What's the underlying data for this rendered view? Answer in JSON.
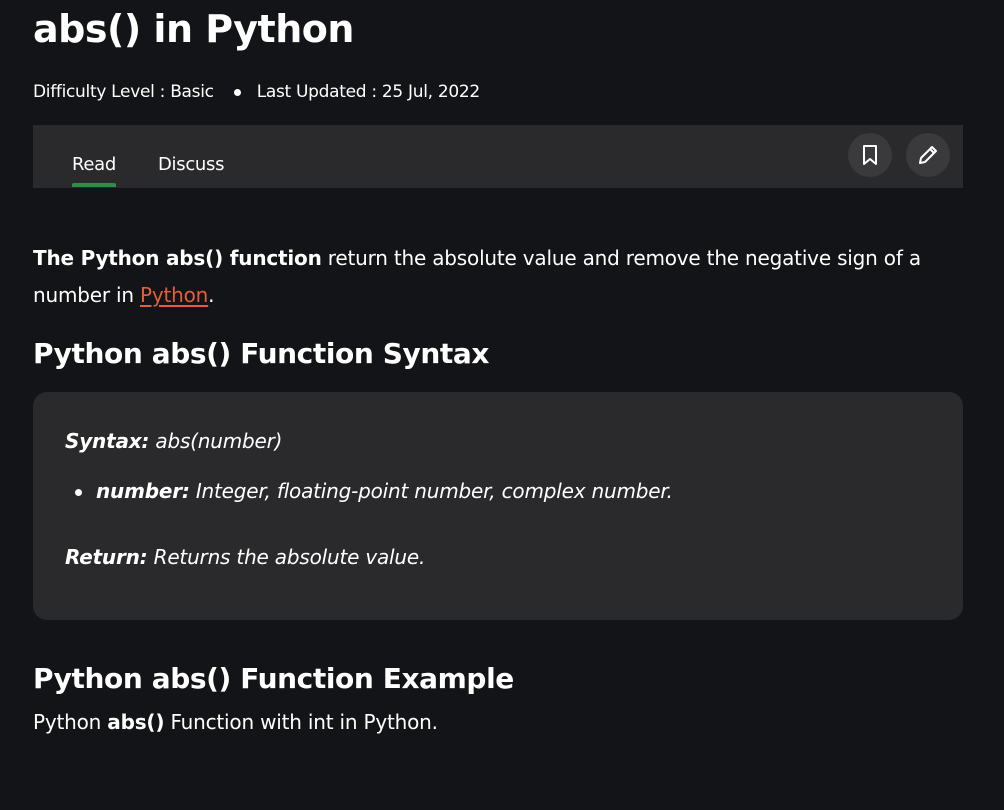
{
  "article": {
    "title": "abs() in Python",
    "difficulty": "Difficulty Level : Basic",
    "last_updated": "Last Updated : 25 Jul, 2022"
  },
  "tabs": {
    "read_label": "Read",
    "discuss_label": "Discuss",
    "active": "Read"
  },
  "icons": {
    "bookmark": "bookmark-icon",
    "edit": "pencil-icon"
  },
  "intro": {
    "bold": "The Python abs() function",
    "text": " return the absolute value and remove the negative sign of a number in ",
    "link": "Python",
    "end": "."
  },
  "sections": {
    "syntax_heading": "Python abs() Function Syntax",
    "example_heading": "Python abs() Function Example"
  },
  "syntax_box": {
    "syntax_label": "Syntax:",
    "syntax_value": " abs(number)",
    "param_label": "number:",
    "param_value": " Integer, floating-point number, complex number.",
    "return_label": "Return:",
    "return_value": " Returns the absolute value."
  },
  "example": {
    "pre": "Python ",
    "bold": "abs()",
    "post": " Function with int in Python."
  },
  "colors": {
    "background": "#131417",
    "panel": "#2a2a2c",
    "accent_green": "#2f8d46",
    "link": "#e35e3c"
  }
}
